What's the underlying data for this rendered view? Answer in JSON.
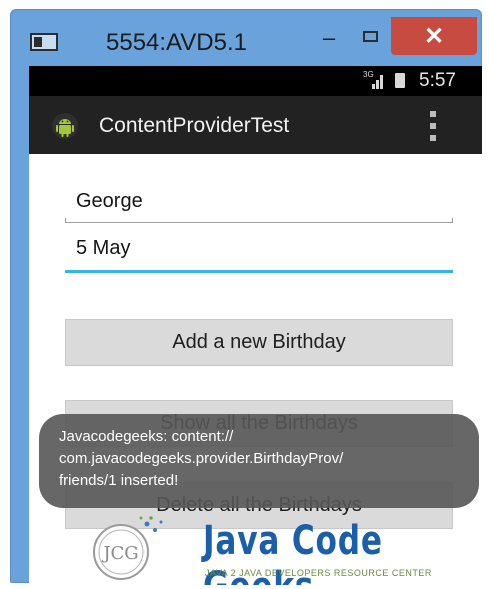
{
  "window": {
    "title": "5554:AVD5.1",
    "minimize_label": "–",
    "close_label": "✕",
    "icons": {
      "window_icon": "emulator-window-icon",
      "minimize": "minimize-icon",
      "maximize": "maximize-icon",
      "close": "close-icon"
    },
    "colors": {
      "frame": "#6aa3dc",
      "close_button": "#c84b42"
    }
  },
  "statusbar": {
    "network_type": "3G",
    "time": "5:57",
    "icons": {
      "signal": "cell-signal-icon",
      "battery": "battery-icon"
    }
  },
  "actionbar": {
    "app_title": "ContentProviderTest",
    "icons": {
      "app": "android-robot-icon",
      "overflow": "overflow-menu-icon"
    }
  },
  "form": {
    "name_value": "George",
    "date_value": "5 May",
    "focus_color": "#33b5e5"
  },
  "buttons": {
    "add": "Add a new Birthday",
    "show": "Show all the Birthdays",
    "delete": "Delete all the Birthdays"
  },
  "toast": {
    "lines": [
      "Javacodegeeks: content://",
      "com.javacodegeeks.provider.BirthdayProv/",
      "friends/1 inserted!"
    ]
  },
  "watermark": {
    "logo_text": "JCG",
    "brand": "Java Code Geeks",
    "tagline": "JAVA 2 JAVA DEVELOPERS RESOURCE CENTER"
  }
}
